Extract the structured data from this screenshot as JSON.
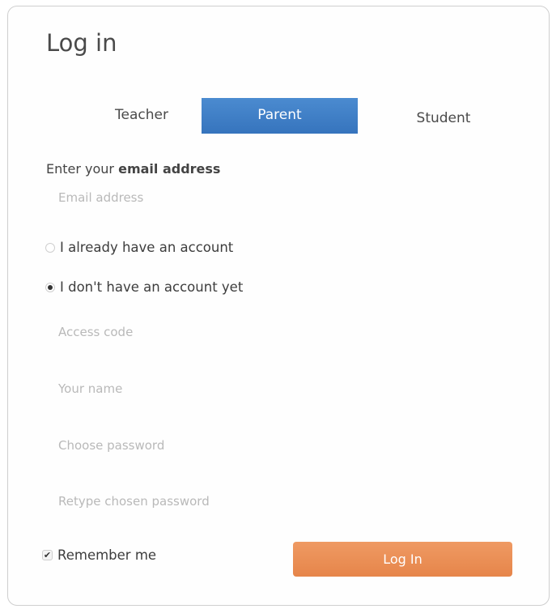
{
  "form": {
    "title": "Log in",
    "tabs": [
      {
        "label": "Teacher",
        "selected": false
      },
      {
        "label": "Parent",
        "selected": true
      },
      {
        "label": "Student",
        "selected": false
      }
    ],
    "email_section": {
      "label_prefix": "Enter your ",
      "label_bold": "email address",
      "email_placeholder": "Email address",
      "email_value": ""
    },
    "account_options": [
      {
        "label": "I already have an account",
        "selected": false
      },
      {
        "label": "I don't have an account yet",
        "selected": true
      }
    ],
    "fields": {
      "access_code_placeholder": "Access code",
      "name_placeholder": "Your name",
      "password_placeholder": "Choose password",
      "retype_password_placeholder": "Retype chosen password"
    },
    "remember_me": {
      "label": "Remember me",
      "checked": true,
      "check_glyph": "✔"
    },
    "submit_label": "Log In"
  },
  "colors": {
    "tab_active": "#3d7cc4",
    "button": "#e98c51"
  }
}
